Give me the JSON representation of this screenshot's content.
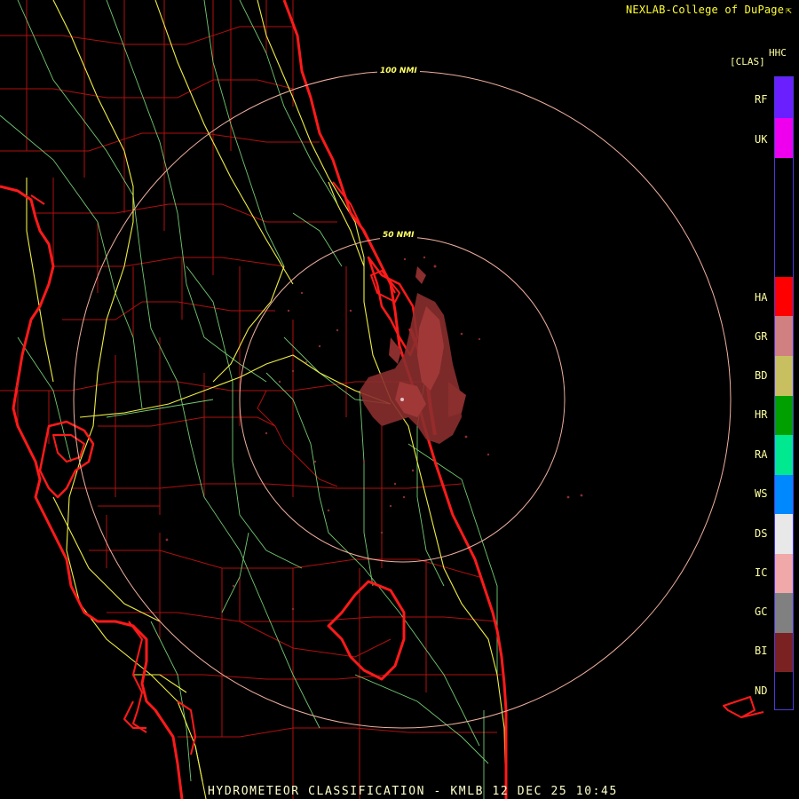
{
  "header": {
    "credit": "NEXLAB-College of DuPage",
    "credit_mark": "⇱"
  },
  "legend": {
    "product_code": "HHC",
    "bracket_label": "[CLAS]",
    "categories": [
      {
        "code": "RF",
        "color": "#6a1fff"
      },
      {
        "code": "UK",
        "color": "#ee00ee"
      },
      {
        "code": "HA",
        "color": "#ff0000"
      },
      {
        "code": "GR",
        "color": "#d08080"
      },
      {
        "code": "BD",
        "color": "#c8c060"
      },
      {
        "code": "HR",
        "color": "#00a000"
      },
      {
        "code": "RA",
        "color": "#00e890"
      },
      {
        "code": "WS",
        "color": "#0088ff"
      },
      {
        "code": "DS",
        "color": "#e8e8e8"
      },
      {
        "code": "IC",
        "color": "#f0a8a8"
      },
      {
        "code": "GC",
        "color": "#808080"
      },
      {
        "code": "BI",
        "color": "#7a2222"
      },
      {
        "code": "ND",
        "color": "#000000"
      }
    ]
  },
  "map": {
    "range_rings": [
      {
        "label": "100 NMI"
      },
      {
        "label": "50 NMI"
      }
    ],
    "colors": {
      "coast": "#ff1a1a",
      "counties": "#b01010",
      "highways": "#eeee44",
      "roads": "#7fe07f",
      "rings": "#f0b0a0",
      "echo": "#8a2e2e"
    }
  },
  "footer": {
    "caption": "HYDROMETEOR CLASSIFICATION - KMLB 12 DEC 25 10:45"
  }
}
